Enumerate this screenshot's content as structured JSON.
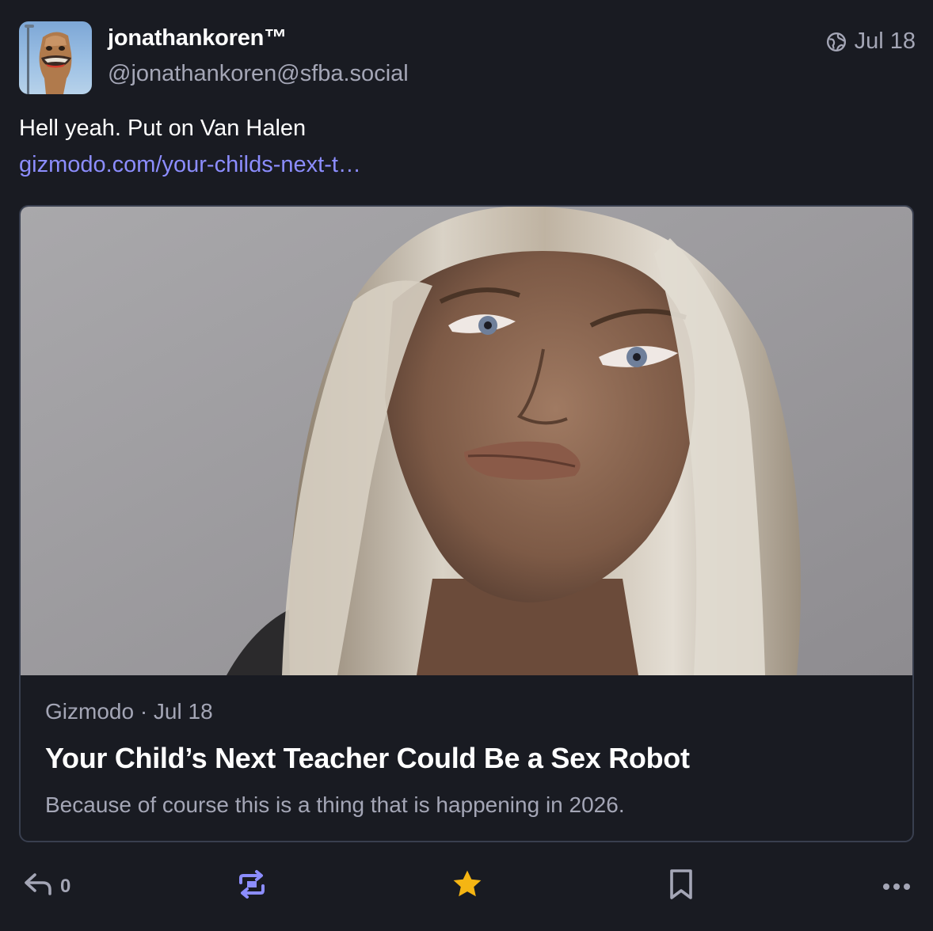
{
  "post": {
    "display_name": "jonathankoren™",
    "handle": "@jonathankoren@sfba.social",
    "date": "Jul 18",
    "visibility_icon": "globe-icon",
    "text": "Hell yeah. Put on Van Halen",
    "link_text": "gizmodo.com/your-childs-next-t…"
  },
  "card": {
    "source": "Gizmodo · Jul 18",
    "title": "Your Child’s Next Teacher Could Be a Sex Robot",
    "description": "Because of course this is a thing that is happening in 2026."
  },
  "actions": {
    "reply_count": "0",
    "icons": [
      "reply-icon",
      "boost-icon",
      "star-icon",
      "bookmark-icon",
      "more-icon"
    ],
    "boost_color": "#8c8dff",
    "favourite_color": "#ca8f04"
  },
  "colors": {
    "background": "#191b22",
    "link": "#8c8dff",
    "muted": "#a4a6b6",
    "border": "#393f4f"
  }
}
